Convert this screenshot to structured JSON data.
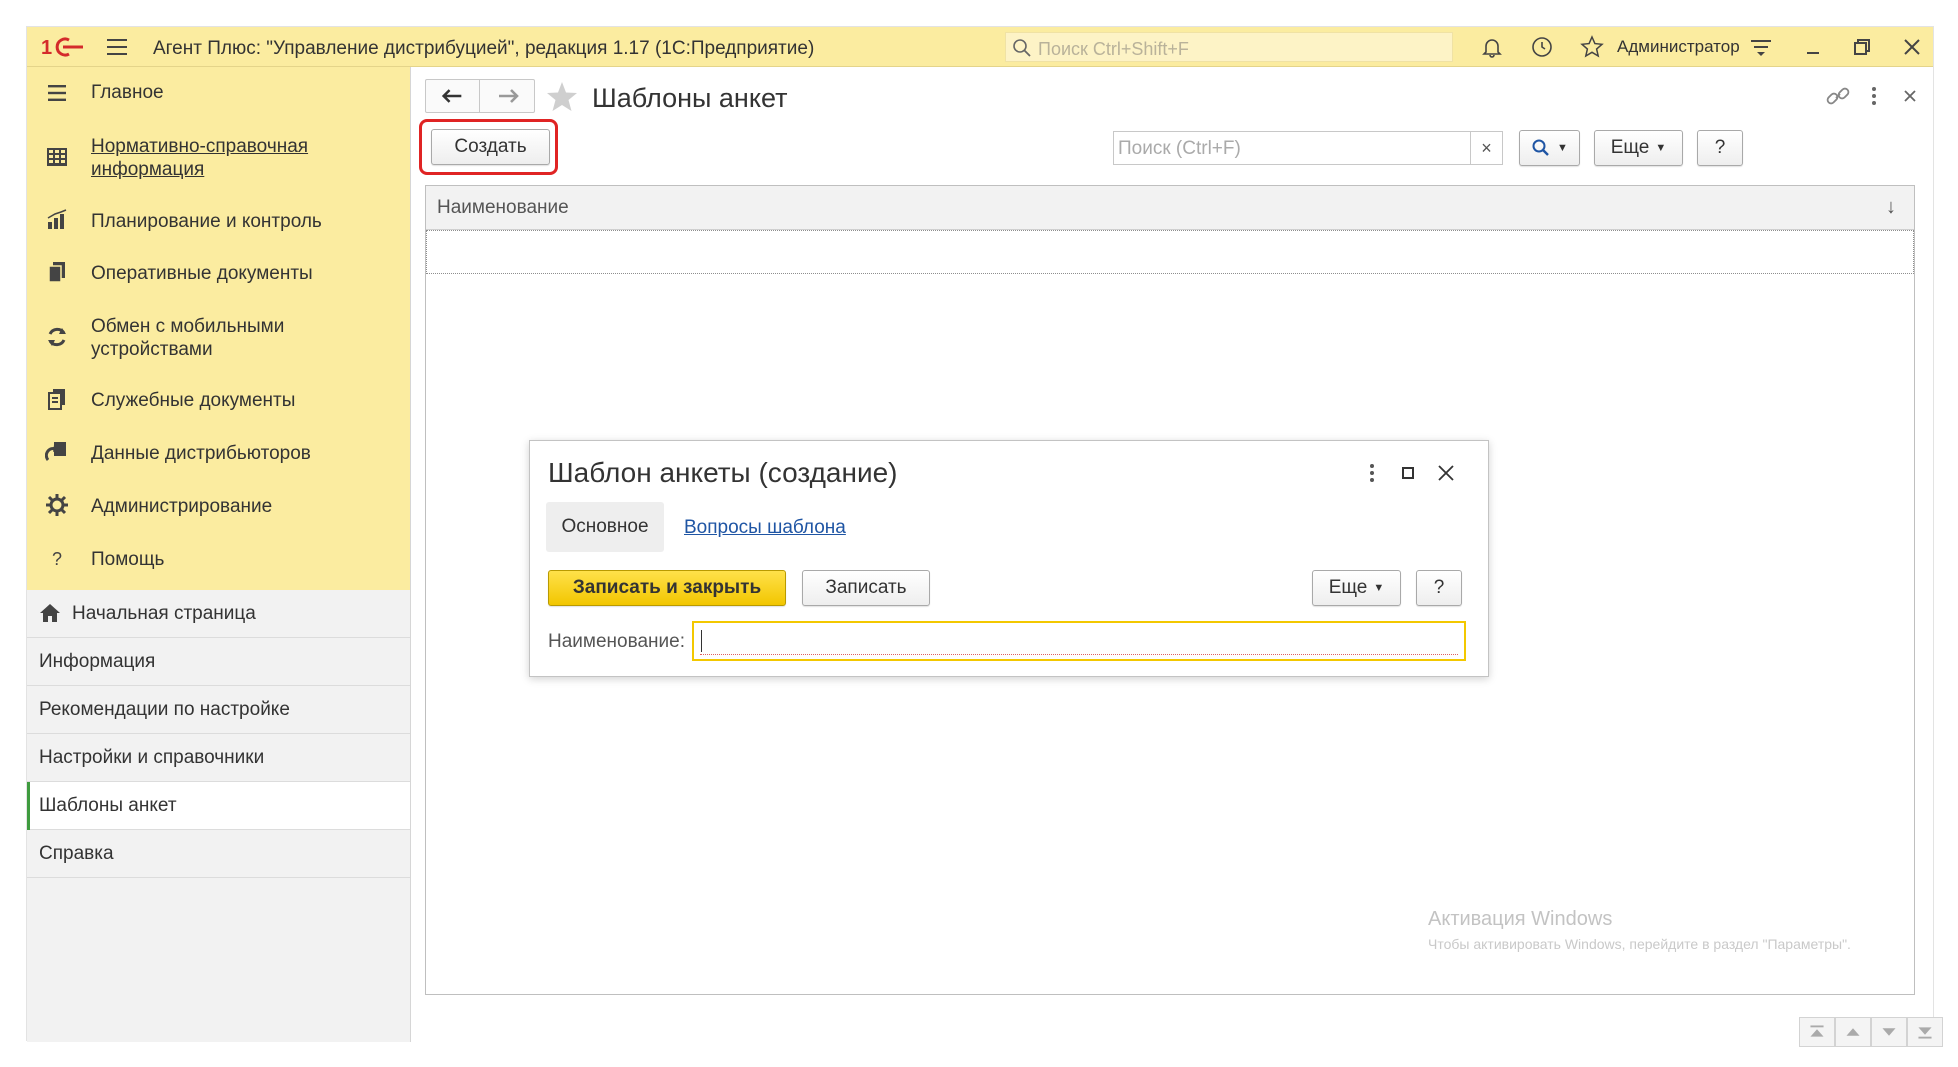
{
  "titlebar": {
    "title": "Агент Плюс: \"Управление дистрибуцией\", редакция 1.17  (1С:Предприятие)",
    "search_placeholder": "Поиск Ctrl+Shift+F",
    "user": "Администратор",
    "icons": [
      "logo-1c-icon",
      "main-menu-icon",
      "search-icon",
      "bell-icon",
      "history-icon",
      "favorites-star-icon",
      "settings-menu-icon",
      "minimize-icon",
      "restore-icon",
      "close-icon"
    ]
  },
  "sidebar": {
    "sections": [
      {
        "label": "Главное",
        "icon": "menu-lines-icon"
      },
      {
        "label": "Нормативно-справочная информация",
        "icon": "table-icon"
      },
      {
        "label": "Планирование и контроль",
        "icon": "bar-chart-icon"
      },
      {
        "label": "Оперативные документы",
        "icon": "documents-icon"
      },
      {
        "label": "Обмен с мобильными устройствами",
        "icon": "sync-icon"
      },
      {
        "label": "Служебные документы",
        "icon": "service-docs-icon"
      },
      {
        "label": "Данные дистрибьюторов",
        "icon": "distributor-icon"
      },
      {
        "label": "Администрирование",
        "icon": "gear-icon"
      },
      {
        "label": "Помощь",
        "icon": "question-icon"
      }
    ],
    "nav": [
      {
        "label": "Начальная страница",
        "icon": "home-icon"
      },
      {
        "label": "Информация"
      },
      {
        "label": "Рекомендации по настройке"
      },
      {
        "label": "Настройки и справочники"
      },
      {
        "label": "Шаблоны анкет"
      },
      {
        "label": "Справка"
      }
    ]
  },
  "main": {
    "title": "Шаблоны анкет",
    "create_label": "Создать",
    "search_placeholder": "Поиск (Ctrl+F)",
    "clear_label": "×",
    "more_label": "Еще",
    "help_label": "?",
    "grid": {
      "column": "Наименование",
      "sort_indicator": "↓"
    },
    "watermark": {
      "line1": "Активация Windows",
      "line2": "Чтобы активировать Windows, перейдите в раздел \"Параметры\"."
    }
  },
  "dialog": {
    "title": "Шаблон анкеты (создание)",
    "tabs": [
      "Основное",
      "Вопросы шаблона"
    ],
    "save_close_label": "Записать и закрыть",
    "save_label": "Записать",
    "more_label": "Еще",
    "help_label": "?",
    "name_label": "Наименование:",
    "name_value": ""
  },
  "colors": {
    "accent_yellow": "#fbeca0",
    "primary_button": "#f5cc00",
    "highlight_red": "#e02424",
    "link_blue": "#1f55a4"
  }
}
